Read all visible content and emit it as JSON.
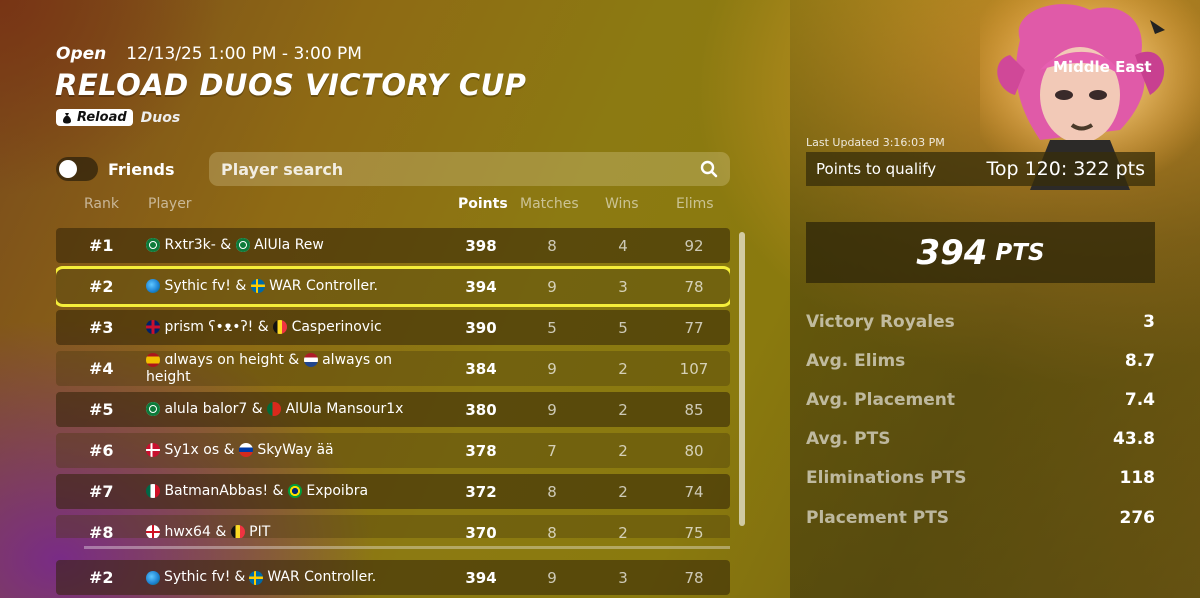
{
  "event": {
    "status": "Open",
    "time": "12/13/25 1:00 PM - 3:00 PM",
    "title": "RELOAD DUOS VICTORY CUP",
    "tag_reload": "Reload",
    "tag_duos": "Duos",
    "region": "Middle East"
  },
  "filters": {
    "friends_label": "Friends",
    "friends_on": false,
    "search_placeholder": "Player search"
  },
  "table": {
    "headers": {
      "rank": "Rank",
      "player": "Player",
      "points": "Points",
      "matches": "Matches",
      "wins": "Wins",
      "elims": "Elims"
    },
    "rows": [
      {
        "rank": "#1",
        "p1": "Rxtr3k-",
        "p2": "AlUla Rew",
        "sep": "&",
        "points": "398",
        "matches": "8",
        "wins": "4",
        "elims": "92",
        "flag1": "sa",
        "flag2": "sa"
      },
      {
        "rank": "#2",
        "p1": "Sythic fv!",
        "p2": "WAR Controller.",
        "sep": "&",
        "points": "394",
        "matches": "9",
        "wins": "3",
        "elims": "78",
        "flag1": "globe",
        "flag2": "se"
      },
      {
        "rank": "#3",
        "p1": "prism ʕ•ᴥ•ʔ!",
        "p2": "Casperinovic",
        "sep": "&",
        "points": "390",
        "matches": "5",
        "wins": "5",
        "elims": "77",
        "flag1": "gb",
        "flag2": "be"
      },
      {
        "rank": "#4",
        "p1": "ɑlways on height",
        "p2": "always on height",
        "sep": "&",
        "points": "384",
        "matches": "9",
        "wins": "2",
        "elims": "107",
        "flag1": "es",
        "flag2": "nl"
      },
      {
        "rank": "#5",
        "p1": "alula balor7",
        "p2": "AlUla Mansour1x",
        "sep": "&",
        "points": "380",
        "matches": "9",
        "wins": "2",
        "elims": "85",
        "flag1": "sa",
        "flag2": "pt"
      },
      {
        "rank": "#6",
        "p1": "Sy1x os",
        "p2": "SkyWay ää",
        "sep": "&",
        "points": "378",
        "matches": "7",
        "wins": "2",
        "elims": "80",
        "flag1": "dk",
        "flag2": "ru"
      },
      {
        "rank": "#7",
        "p1": "BatmanAbbas!",
        "p2": "Expoibra",
        "sep": "&",
        "points": "372",
        "matches": "8",
        "wins": "2",
        "elims": "74",
        "flag1": "mx",
        "flag2": "br"
      },
      {
        "rank": "#8",
        "p1": "hwx64",
        "p2": "PIT",
        "sep": "&",
        "points": "370",
        "matches": "8",
        "wins": "2",
        "elims": "75",
        "flag1": "gb-eng",
        "flag2": "be"
      }
    ],
    "self_row": {
      "rank": "#2",
      "p1": "Sythic fv!",
      "p2": "WAR Controller.",
      "sep": "&",
      "points": "394",
      "matches": "9",
      "wins": "3",
      "elims": "78",
      "flag1": "globe",
      "flag2": "se"
    }
  },
  "stats": {
    "last_updated": "Last Updated 3:16:03 PM",
    "qualify_label": "Points to qualify",
    "qualify_value": "Top 120: 322 pts",
    "total_points": "394",
    "total_points_unit": "PTS",
    "items": [
      {
        "label": "Victory Royales",
        "value": "3"
      },
      {
        "label": "Avg. Elims",
        "value": "8.7"
      },
      {
        "label": "Avg. Placement",
        "value": "7.4"
      },
      {
        "label": "Avg. PTS",
        "value": "43.8"
      },
      {
        "label": "Eliminations PTS",
        "value": "118"
      },
      {
        "label": "Placement PTS",
        "value": "276"
      }
    ]
  },
  "colors": {
    "highlight": "#f5ee3a",
    "background": "#8c7a12"
  }
}
